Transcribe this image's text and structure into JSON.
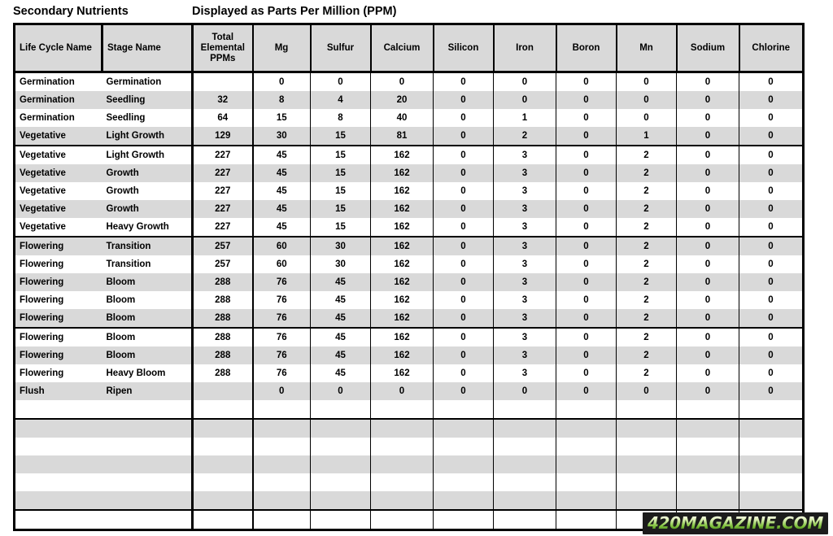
{
  "title": {
    "left": "Secondary Nutrients",
    "right": "Displayed as Parts Per Million (PPM)"
  },
  "table": {
    "columns": [
      "Life Cycle Name",
      "Stage Name",
      "Total Elemental PPMs",
      "Mg",
      "Sulfur",
      "Calcium",
      "Silicon",
      "Iron",
      "Boron",
      "Mn",
      "Sodium",
      "Chlorine"
    ],
    "column_header_lines": {
      "total": [
        "Total",
        "Elemental",
        "PPMs"
      ]
    },
    "rows": [
      {
        "life": "Germination",
        "stage": "Germination",
        "total": "",
        "mg": "0",
        "sulfur": "0",
        "calcium": "0",
        "silicon": "0",
        "iron": "0",
        "boron": "0",
        "mn": "0",
        "sodium": "0",
        "chlorine": "0",
        "shaded": false
      },
      {
        "life": "Germination",
        "stage": "Seedling",
        "total": "32",
        "mg": "8",
        "sulfur": "4",
        "calcium": "20",
        "silicon": "0",
        "iron": "0",
        "boron": "0",
        "mn": "0",
        "sodium": "0",
        "chlorine": "0",
        "shaded": true
      },
      {
        "life": "Germination",
        "stage": "Seedling",
        "total": "64",
        "mg": "15",
        "sulfur": "8",
        "calcium": "40",
        "silicon": "0",
        "iron": "1",
        "boron": "0",
        "mn": "0",
        "sodium": "0",
        "chlorine": "0",
        "shaded": false
      },
      {
        "life": "Vegetative",
        "stage": "Light Growth",
        "total": "129",
        "mg": "30",
        "sulfur": "15",
        "calcium": "81",
        "silicon": "0",
        "iron": "2",
        "boron": "0",
        "mn": "1",
        "sodium": "0",
        "chlorine": "0",
        "shaded": true,
        "separator_below": true
      },
      {
        "life": "Vegetative",
        "stage": "Light Growth",
        "total": "227",
        "mg": "45",
        "sulfur": "15",
        "calcium": "162",
        "silicon": "0",
        "iron": "3",
        "boron": "0",
        "mn": "2",
        "sodium": "0",
        "chlorine": "0",
        "shaded": false
      },
      {
        "life": "Vegetative",
        "stage": "Growth",
        "total": "227",
        "mg": "45",
        "sulfur": "15",
        "calcium": "162",
        "silicon": "0",
        "iron": "3",
        "boron": "0",
        "mn": "2",
        "sodium": "0",
        "chlorine": "0",
        "shaded": true
      },
      {
        "life": "Vegetative",
        "stage": "Growth",
        "total": "227",
        "mg": "45",
        "sulfur": "15",
        "calcium": "162",
        "silicon": "0",
        "iron": "3",
        "boron": "0",
        "mn": "2",
        "sodium": "0",
        "chlorine": "0",
        "shaded": false
      },
      {
        "life": "Vegetative",
        "stage": "Growth",
        "total": "227",
        "mg": "45",
        "sulfur": "15",
        "calcium": "162",
        "silicon": "0",
        "iron": "3",
        "boron": "0",
        "mn": "2",
        "sodium": "0",
        "chlorine": "0",
        "shaded": true
      },
      {
        "life": "Vegetative",
        "stage": "Heavy Growth",
        "total": "227",
        "mg": "45",
        "sulfur": "15",
        "calcium": "162",
        "silicon": "0",
        "iron": "3",
        "boron": "0",
        "mn": "2",
        "sodium": "0",
        "chlorine": "0",
        "shaded": false,
        "separator_below": true
      },
      {
        "life": "Flowering",
        "stage": "Transition",
        "total": "257",
        "mg": "60",
        "sulfur": "30",
        "calcium": "162",
        "silicon": "0",
        "iron": "3",
        "boron": "0",
        "mn": "2",
        "sodium": "0",
        "chlorine": "0",
        "shaded": true
      },
      {
        "life": "Flowering",
        "stage": "Transition",
        "total": "257",
        "mg": "60",
        "sulfur": "30",
        "calcium": "162",
        "silicon": "0",
        "iron": "3",
        "boron": "0",
        "mn": "2",
        "sodium": "0",
        "chlorine": "0",
        "shaded": false
      },
      {
        "life": "Flowering",
        "stage": "Bloom",
        "total": "288",
        "mg": "76",
        "sulfur": "45",
        "calcium": "162",
        "silicon": "0",
        "iron": "3",
        "boron": "0",
        "mn": "2",
        "sodium": "0",
        "chlorine": "0",
        "shaded": true
      },
      {
        "life": "Flowering",
        "stage": "Bloom",
        "total": "288",
        "mg": "76",
        "sulfur": "45",
        "calcium": "162",
        "silicon": "0",
        "iron": "3",
        "boron": "0",
        "mn": "2",
        "sodium": "0",
        "chlorine": "0",
        "shaded": false
      },
      {
        "life": "Flowering",
        "stage": "Bloom",
        "total": "288",
        "mg": "76",
        "sulfur": "45",
        "calcium": "162",
        "silicon": "0",
        "iron": "3",
        "boron": "0",
        "mn": "2",
        "sodium": "0",
        "chlorine": "0",
        "shaded": true,
        "separator_below": true
      },
      {
        "life": "Flowering",
        "stage": "Bloom",
        "total": "288",
        "mg": "76",
        "sulfur": "45",
        "calcium": "162",
        "silicon": "0",
        "iron": "3",
        "boron": "0",
        "mn": "2",
        "sodium": "0",
        "chlorine": "0",
        "shaded": false
      },
      {
        "life": "Flowering",
        "stage": "Bloom",
        "total": "288",
        "mg": "76",
        "sulfur": "45",
        "calcium": "162",
        "silicon": "0",
        "iron": "3",
        "boron": "0",
        "mn": "2",
        "sodium": "0",
        "chlorine": "0",
        "shaded": true
      },
      {
        "life": "Flowering",
        "stage": "Heavy Bloom",
        "total": "288",
        "mg": "76",
        "sulfur": "45",
        "calcium": "162",
        "silicon": "0",
        "iron": "3",
        "boron": "0",
        "mn": "2",
        "sodium": "0",
        "chlorine": "0",
        "shaded": false
      },
      {
        "life": "Flush",
        "stage": "Ripen",
        "total": "",
        "mg": "0",
        "sulfur": "0",
        "calcium": "0",
        "silicon": "0",
        "iron": "0",
        "boron": "0",
        "mn": "0",
        "sodium": "0",
        "chlorine": "0",
        "shaded": true
      }
    ],
    "empty_rows": [
      {
        "shaded": false
      },
      {
        "shaded": true,
        "separator_above": true
      },
      {
        "shaded": false
      },
      {
        "shaded": true
      },
      {
        "shaded": false
      },
      {
        "shaded": true
      },
      {
        "shaded": false,
        "separator_above": true
      }
    ]
  },
  "watermark": {
    "text": "420MAGAZINE.COM"
  },
  "colors": {
    "shade": "#d9d9d9",
    "border": "#000000",
    "background": "#ffffff",
    "watermark_green": "#7ec13a"
  }
}
